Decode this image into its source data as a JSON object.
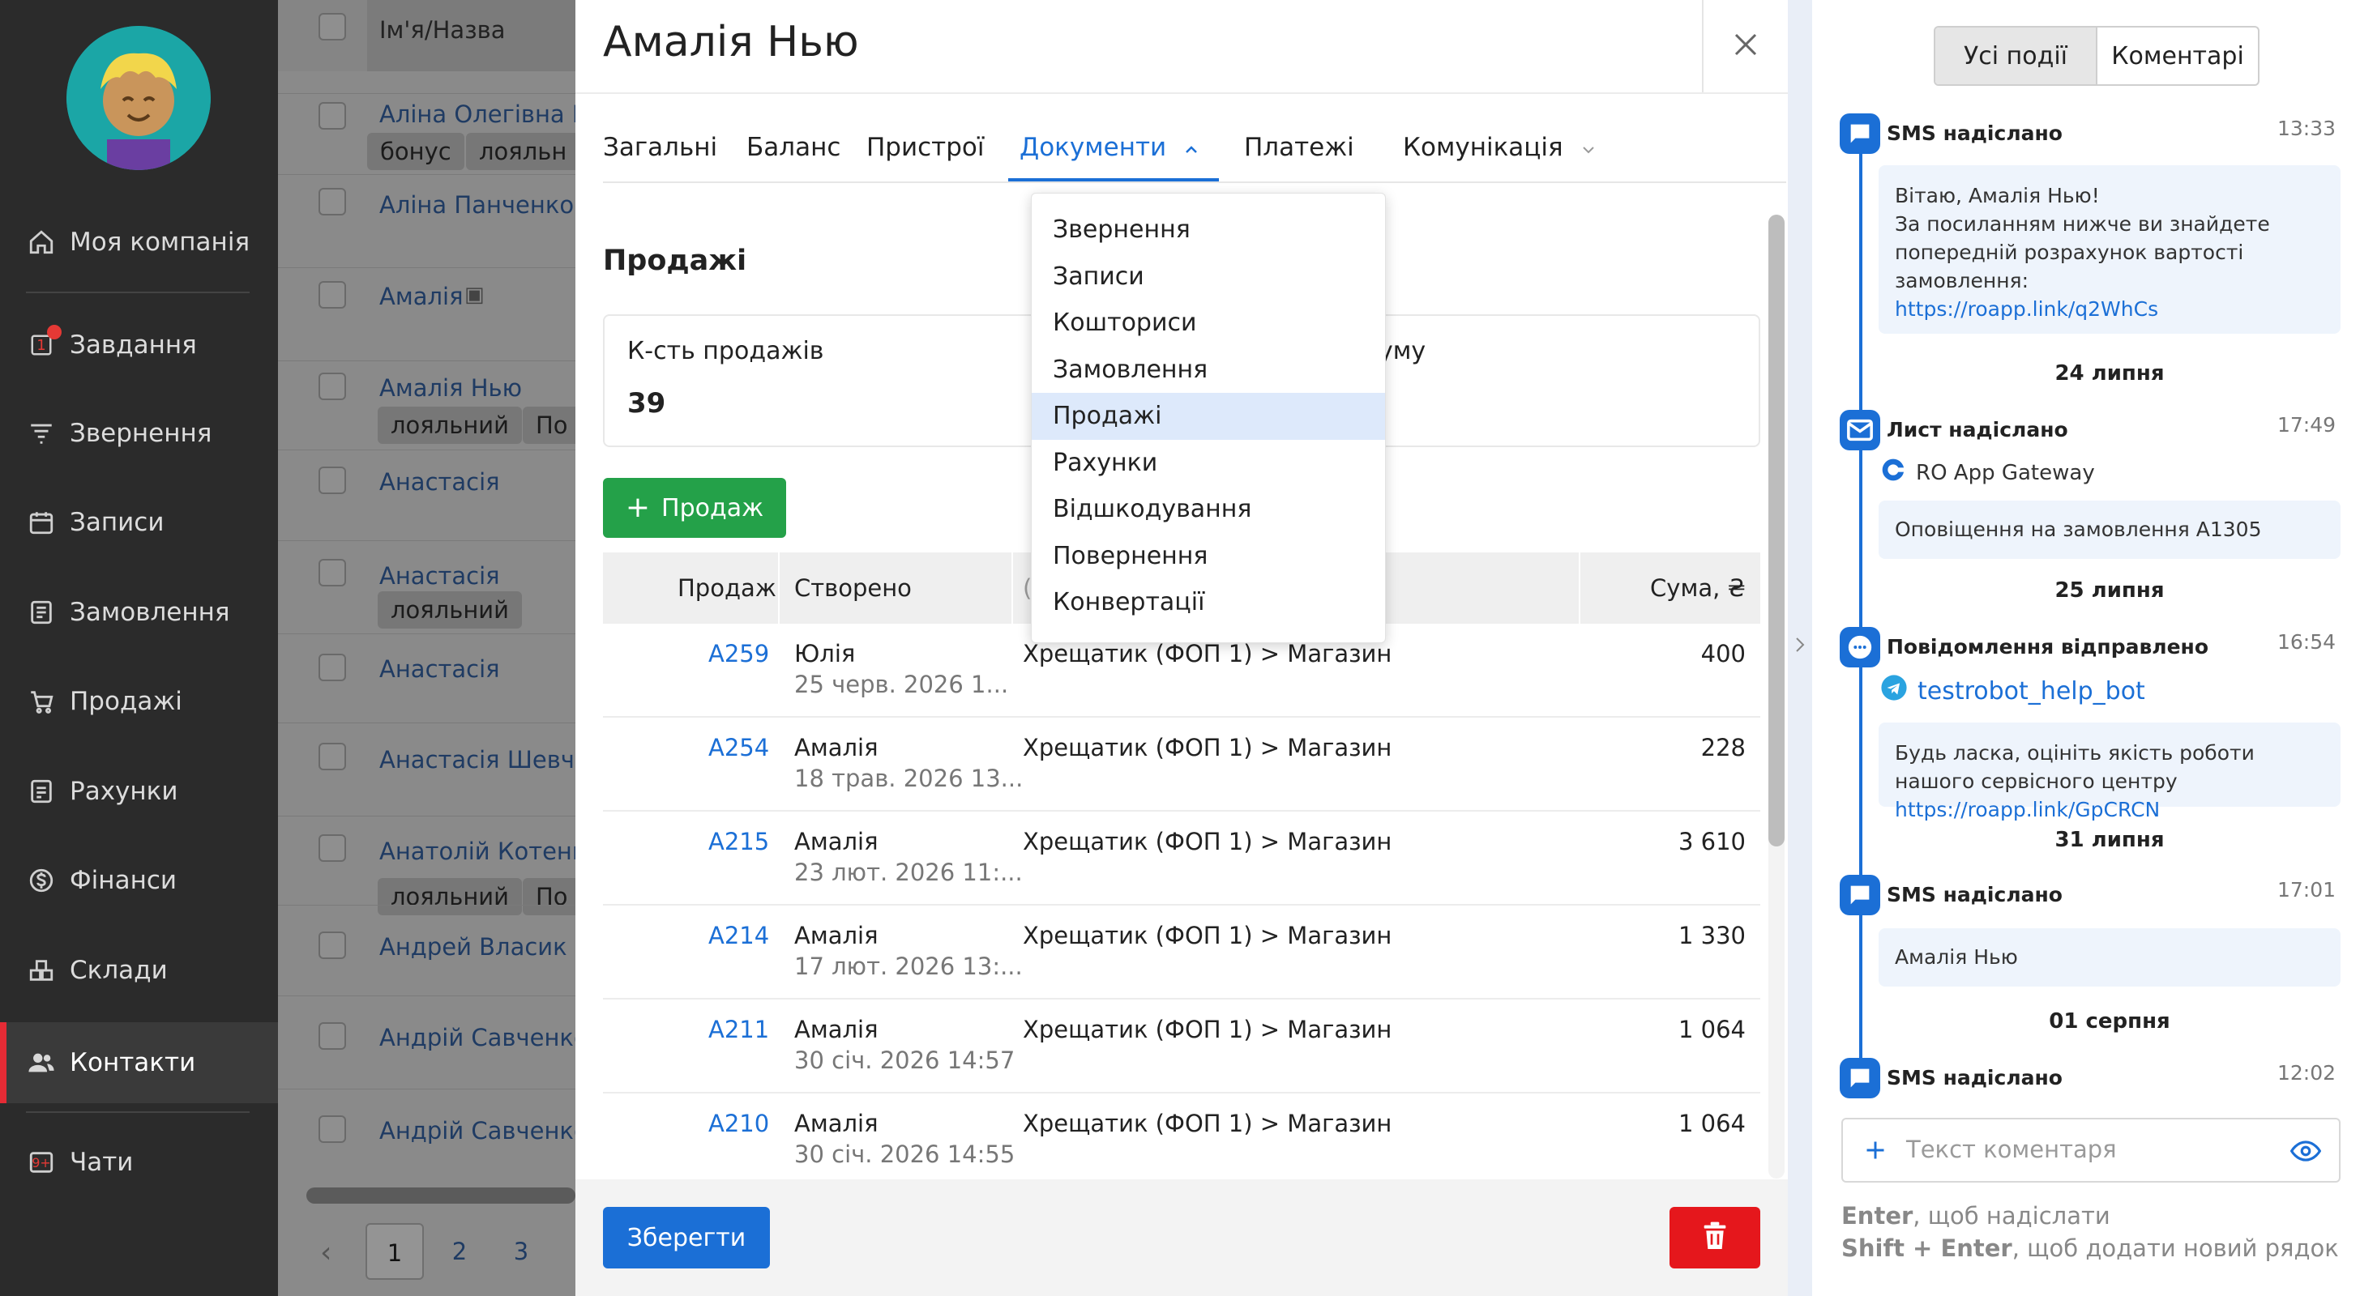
{
  "sidebar": {
    "items": [
      {
        "label": "Моя компанія",
        "icon": "home-icon"
      },
      {
        "label": "Завдання",
        "icon": "task-icon",
        "badge": "1"
      },
      {
        "label": "Звернення",
        "icon": "funnel-icon"
      },
      {
        "label": "Записи",
        "icon": "calendar-icon"
      },
      {
        "label": "Замовлення",
        "icon": "order-icon"
      },
      {
        "label": "Продажі",
        "icon": "cart-icon"
      },
      {
        "label": "Рахунки",
        "icon": "invoice-icon"
      },
      {
        "label": "Фінанси",
        "icon": "dollar-icon"
      },
      {
        "label": "Склади",
        "icon": "warehouse-icon"
      },
      {
        "label": "Контакти",
        "icon": "contacts-icon",
        "active": true
      },
      {
        "label": "Чати",
        "icon": "chat-icon",
        "badge": "9+"
      }
    ]
  },
  "background_list": {
    "header": "Ім'я/Назва",
    "rows": [
      {
        "name": "Аліна Олегівна П",
        "tags": [
          "бонус",
          "лояльн"
        ]
      },
      {
        "name": "Аліна Панченко",
        "tags": []
      },
      {
        "name": "Амалія",
        "tags": []
      },
      {
        "name": "Амалія Нью",
        "tags": [
          "лояльний",
          "По"
        ]
      },
      {
        "name": "Анастасія",
        "tags": []
      },
      {
        "name": "Анастасія",
        "tags": [
          "лояльний"
        ]
      },
      {
        "name": "Анастасія",
        "tags": []
      },
      {
        "name": "Анастасія Шевче",
        "tags": []
      },
      {
        "name": "Анатолій Котенко",
        "tags": [
          "лояльний",
          "По"
        ]
      },
      {
        "name": "Андрей Власик",
        "tags": []
      },
      {
        "name": "Андрій Савченко",
        "tags": []
      },
      {
        "name": "Андрій Савченко",
        "tags": []
      }
    ],
    "pages": [
      "1",
      "2",
      "3"
    ]
  },
  "modal": {
    "title": "Амалія Нью",
    "tabs": [
      "Загальні",
      "Баланс",
      "Пристрої",
      "Документи",
      "Платежі",
      "Комунікація"
    ],
    "active_tab": "Документи",
    "section_title": "Продажі",
    "stats": {
      "count_label": "К-сть продажів",
      "count_value": "39",
      "sum_label_partial": "уму"
    },
    "add_button": "Продаж",
    "table": {
      "headers": {
        "sale": "Продаж",
        "created": "Створено",
        "location_partial": "(",
        "sum": "Сума, ₴"
      },
      "rows": [
        {
          "id": "A259",
          "user": "Юлія",
          "date": "25 черв. 2026 1...",
          "location": "Хрещатик (ФОП 1) > Магазин",
          "sum": "400"
        },
        {
          "id": "A254",
          "user": "Амалія",
          "date": "18 трав. 2026 13...",
          "location": "Хрещатик (ФОП 1) > Магазин",
          "sum": "228"
        },
        {
          "id": "A215",
          "user": "Амалія",
          "date": "23 лют. 2026 11:...",
          "location": "Хрещатик (ФОП 1) > Магазин",
          "sum": "3 610"
        },
        {
          "id": "A214",
          "user": "Амалія",
          "date": "17 лют. 2026 13:...",
          "location": "Хрещатик (ФОП 1) > Магазин",
          "sum": "1 330"
        },
        {
          "id": "A211",
          "user": "Амалія",
          "date": "30 січ. 2026 14:57",
          "location": "Хрещатик (ФОП 1) > Магазин",
          "sum": "1 064"
        },
        {
          "id": "A210",
          "user": "Амалія",
          "date": "30 січ. 2026 14:55",
          "location": "Хрещатик (ФОП 1) > Магазин",
          "sum": "1 064"
        }
      ]
    },
    "save_button": "Зберегти",
    "dropdown": {
      "items": [
        "Звернення",
        "Записи",
        "Кошториси",
        "Замовлення",
        "Продажі",
        "Рахунки",
        "Відшкодування",
        "Повернення",
        "Конвертації"
      ],
      "selected": "Продажі"
    }
  },
  "panel": {
    "filters": [
      "Усі події",
      "Коментарі"
    ],
    "active_filter": "Усі події",
    "events": [
      {
        "type": "sms",
        "title": "SMS надіслано",
        "time": "13:33",
        "lines": [
          "Вітаю, Амалія Нью!",
          "За посиланням нижче ви знайдете",
          "попередній розрахунок вартості",
          "замовлення:"
        ],
        "link": "https://roapp.link/q2WhCs"
      },
      {
        "date": "24 липня"
      },
      {
        "type": "mail",
        "title": "Лист надіслано",
        "time": "17:49",
        "sender": "RO App Gateway",
        "text": "Оповіщення на замовлення A1305"
      },
      {
        "date": "25 липня"
      },
      {
        "type": "msg",
        "title": "Повідомлення відправлено",
        "time": "16:54",
        "bot": "testrobot_help_bot",
        "text": "Будь ласка, оцініть якість роботи нашого сервісного центру",
        "link": "https://roapp.link/GpCRCN"
      },
      {
        "date": "31 липня"
      },
      {
        "type": "sms",
        "title": "SMS надіслано",
        "time": "17:01",
        "text": "Амалія Нью"
      },
      {
        "date": "01 серпня"
      },
      {
        "type": "sms",
        "title": "SMS надіслано",
        "time": "12:02"
      }
    ],
    "comment_placeholder": "Текст коментаря",
    "hint1_key": "Enter",
    "hint1_text": ", щоб надіслати",
    "hint2_key": "Shift + Enter",
    "hint2_text": ", щоб додати новий рядок"
  },
  "colors": {
    "accent": "#1b6fd6",
    "success": "#24a149",
    "danger": "#e5171c",
    "sidebar_bg": "#2b2b2b"
  }
}
